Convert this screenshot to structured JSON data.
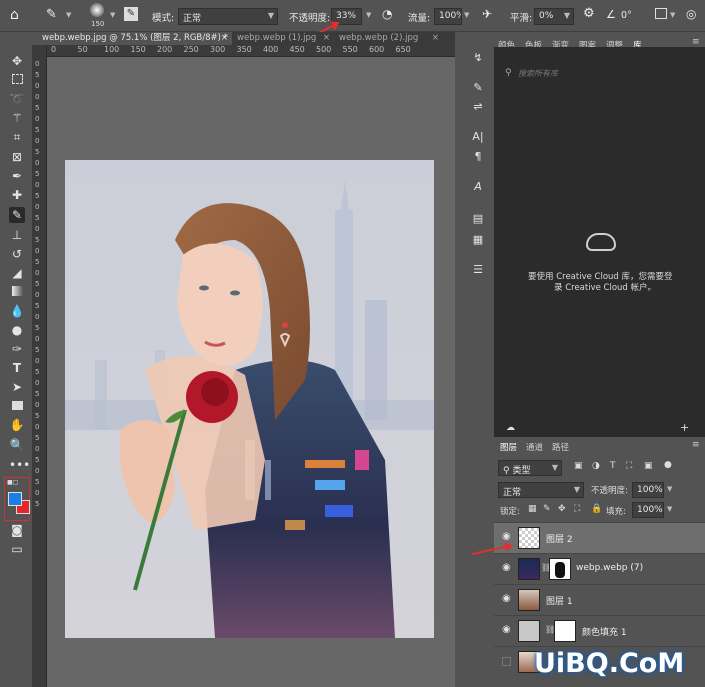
{
  "options_bar": {
    "brush_size": "150",
    "mode_label": "模式:",
    "mode_value": "正常",
    "opacity_label": "不透明度:",
    "opacity_value": "33%",
    "flow_label": "流量:",
    "flow_value": "100%",
    "smooth_label": "平滑:",
    "smooth_value": "0%",
    "angle_value": "0°"
  },
  "doc_tabs": [
    {
      "label": "webp.webp.jpg @ 75.1% (图层 2, RGB/8#) *",
      "close": "×"
    },
    {
      "label": "webp.webp (1).jpg",
      "close": "×"
    },
    {
      "label": "webp.webp (2).jpg",
      "close": "×"
    }
  ],
  "ruler_top": [
    "0",
    "50",
    "100",
    "150",
    "200",
    "250",
    "300",
    "350",
    "400",
    "450",
    "500",
    "550",
    "600",
    "650"
  ],
  "right_panel": {
    "tabs": [
      "颜色",
      "色板",
      "渐变",
      "图案",
      "调整",
      "库"
    ],
    "search_placeholder": "搜索所有库",
    "cc_message_line1": "要使用 Creative Cloud 库，您需要登",
    "cc_message_line2": "录 Creative Cloud 帐户。"
  },
  "layers_panel": {
    "tabs": [
      "图层",
      "通道",
      "路径"
    ],
    "filter_value": "类型",
    "blend_mode": "正常",
    "opacity_label": "不透明度:",
    "opacity_value": "100%",
    "lock_label": "锁定:",
    "fill_label": "填充:",
    "fill_value": "100%",
    "layers": [
      {
        "name": "图层 2",
        "selected": true,
        "visible": true
      },
      {
        "name": "webp.webp (7)",
        "selected": false,
        "visible": true
      },
      {
        "name": "图层 1",
        "selected": false,
        "visible": true
      },
      {
        "name": "颜色填充 1",
        "selected": false,
        "visible": true
      },
      {
        "name": "",
        "selected": false,
        "visible": false
      }
    ]
  },
  "watermark": "UiBQ.CoM",
  "colors": {
    "foreground": "#1a7ee6",
    "background": "#e3262a",
    "annotation_arrow": "#e0312d"
  }
}
